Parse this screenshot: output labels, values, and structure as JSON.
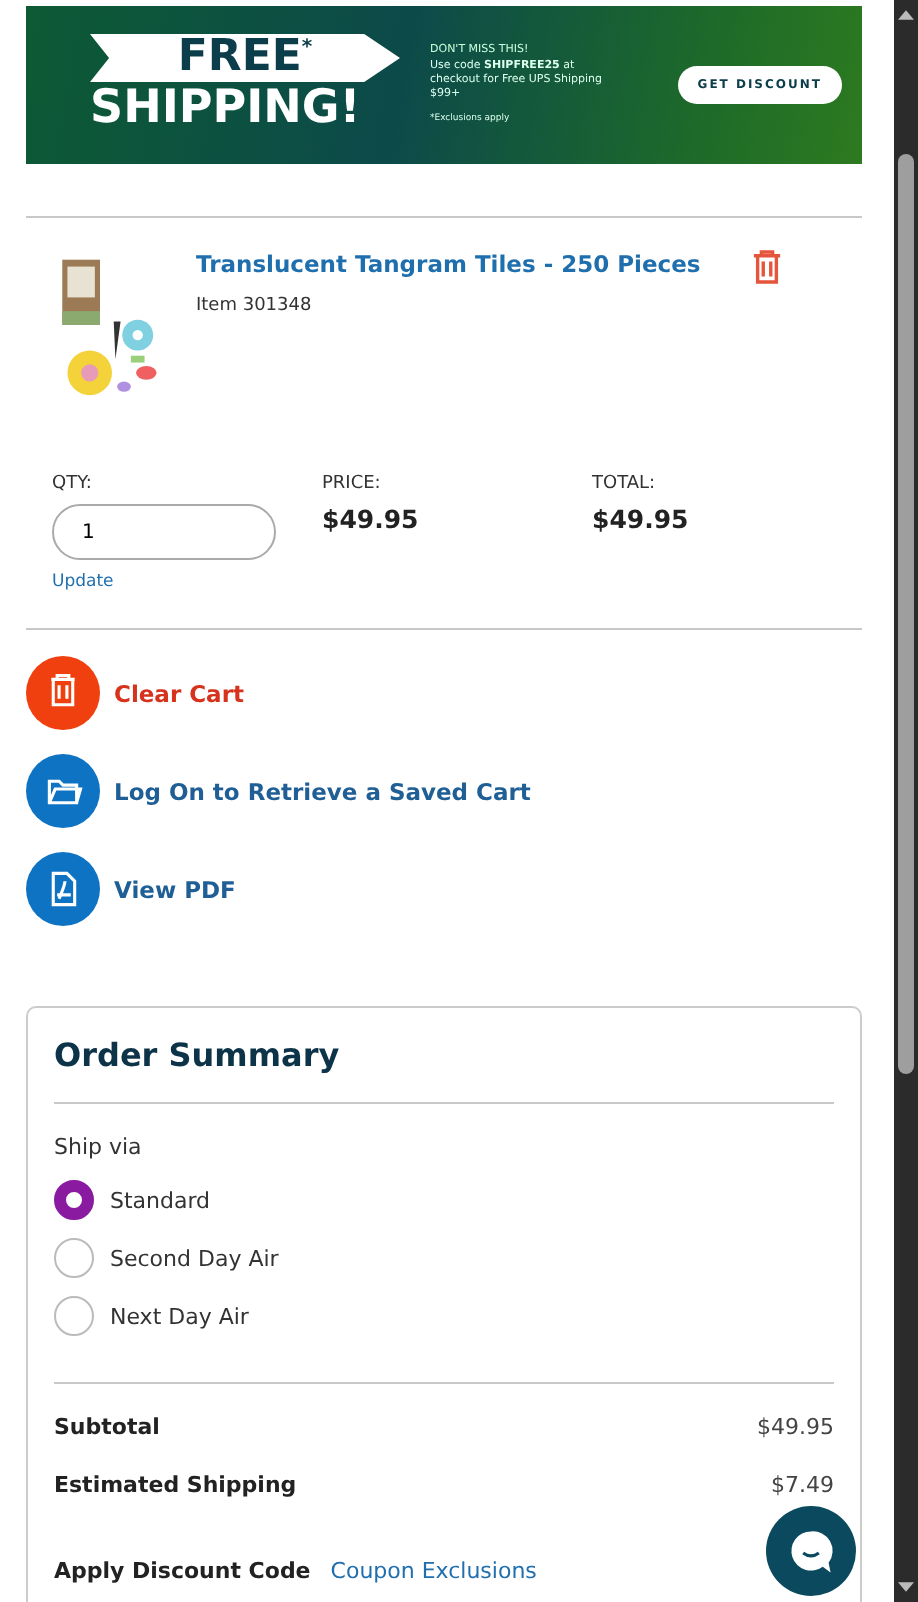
{
  "banner": {
    "headline_top": "FREE",
    "headline_mark": "*",
    "headline_bottom": "SHIPPING!",
    "kicker": "DON'T MISS THIS!",
    "message": "Use code **SHIPFREE25** at checkout for Free UPS Shipping $99+",
    "footnote": "*Exclusions apply",
    "button": "GET DISCOUNT"
  },
  "cart_item": {
    "title": "Translucent Tangram Tiles - 250 Pieces",
    "item_number": "Item 301348",
    "qty_label": "QTY:",
    "qty": "1",
    "update": "Update",
    "price_label": "PRICE:",
    "price": "$49.95",
    "total_label": "TOTAL:",
    "total": "$49.95"
  },
  "actions": [
    {
      "kind": "clear",
      "label": "Clear Cart"
    },
    {
      "kind": "folder",
      "label": "Log On to Retrieve a Saved Cart"
    },
    {
      "kind": "pdf",
      "label": "View PDF"
    }
  ],
  "order_summary": {
    "title": "Order Summary",
    "ship_via_label": "Ship via",
    "ship_options": [
      {
        "label": "Standard",
        "selected": true
      },
      {
        "label": "Second Day Air",
        "selected": false
      },
      {
        "label": "Next Day Air",
        "selected": false
      }
    ],
    "lines": [
      {
        "label": "Subtotal",
        "value": "$49.95"
      },
      {
        "label": "Estimated Shipping",
        "value": "$7.49"
      }
    ],
    "discount_label": "Apply Discount Code",
    "coupon_link": "Coupon Exclusions"
  }
}
